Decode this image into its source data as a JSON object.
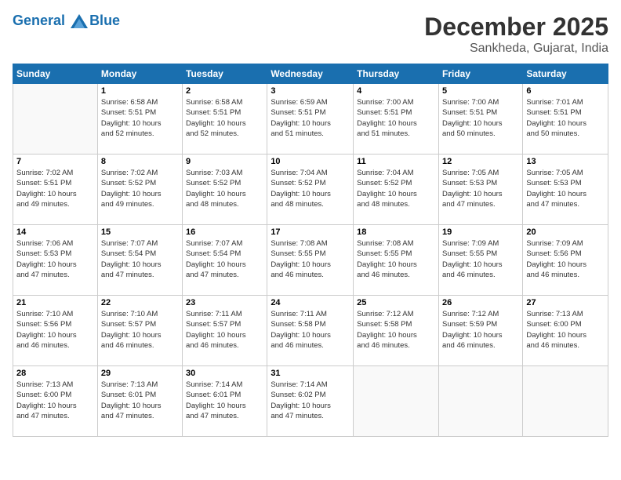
{
  "header": {
    "logo_line1": "General",
    "logo_line2": "Blue",
    "title": "December 2025",
    "subtitle": "Sankheda, Gujarat, India"
  },
  "weekdays": [
    "Sunday",
    "Monday",
    "Tuesday",
    "Wednesday",
    "Thursday",
    "Friday",
    "Saturday"
  ],
  "weeks": [
    [
      {
        "day": "",
        "info": ""
      },
      {
        "day": "1",
        "info": "Sunrise: 6:58 AM\nSunset: 5:51 PM\nDaylight: 10 hours\nand 52 minutes."
      },
      {
        "day": "2",
        "info": "Sunrise: 6:58 AM\nSunset: 5:51 PM\nDaylight: 10 hours\nand 52 minutes."
      },
      {
        "day": "3",
        "info": "Sunrise: 6:59 AM\nSunset: 5:51 PM\nDaylight: 10 hours\nand 51 minutes."
      },
      {
        "day": "4",
        "info": "Sunrise: 7:00 AM\nSunset: 5:51 PM\nDaylight: 10 hours\nand 51 minutes."
      },
      {
        "day": "5",
        "info": "Sunrise: 7:00 AM\nSunset: 5:51 PM\nDaylight: 10 hours\nand 50 minutes."
      },
      {
        "day": "6",
        "info": "Sunrise: 7:01 AM\nSunset: 5:51 PM\nDaylight: 10 hours\nand 50 minutes."
      }
    ],
    [
      {
        "day": "7",
        "info": "Sunrise: 7:02 AM\nSunset: 5:51 PM\nDaylight: 10 hours\nand 49 minutes."
      },
      {
        "day": "8",
        "info": "Sunrise: 7:02 AM\nSunset: 5:52 PM\nDaylight: 10 hours\nand 49 minutes."
      },
      {
        "day": "9",
        "info": "Sunrise: 7:03 AM\nSunset: 5:52 PM\nDaylight: 10 hours\nand 48 minutes."
      },
      {
        "day": "10",
        "info": "Sunrise: 7:04 AM\nSunset: 5:52 PM\nDaylight: 10 hours\nand 48 minutes."
      },
      {
        "day": "11",
        "info": "Sunrise: 7:04 AM\nSunset: 5:52 PM\nDaylight: 10 hours\nand 48 minutes."
      },
      {
        "day": "12",
        "info": "Sunrise: 7:05 AM\nSunset: 5:53 PM\nDaylight: 10 hours\nand 47 minutes."
      },
      {
        "day": "13",
        "info": "Sunrise: 7:05 AM\nSunset: 5:53 PM\nDaylight: 10 hours\nand 47 minutes."
      }
    ],
    [
      {
        "day": "14",
        "info": "Sunrise: 7:06 AM\nSunset: 5:53 PM\nDaylight: 10 hours\nand 47 minutes."
      },
      {
        "day": "15",
        "info": "Sunrise: 7:07 AM\nSunset: 5:54 PM\nDaylight: 10 hours\nand 47 minutes."
      },
      {
        "day": "16",
        "info": "Sunrise: 7:07 AM\nSunset: 5:54 PM\nDaylight: 10 hours\nand 47 minutes."
      },
      {
        "day": "17",
        "info": "Sunrise: 7:08 AM\nSunset: 5:55 PM\nDaylight: 10 hours\nand 46 minutes."
      },
      {
        "day": "18",
        "info": "Sunrise: 7:08 AM\nSunset: 5:55 PM\nDaylight: 10 hours\nand 46 minutes."
      },
      {
        "day": "19",
        "info": "Sunrise: 7:09 AM\nSunset: 5:55 PM\nDaylight: 10 hours\nand 46 minutes."
      },
      {
        "day": "20",
        "info": "Sunrise: 7:09 AM\nSunset: 5:56 PM\nDaylight: 10 hours\nand 46 minutes."
      }
    ],
    [
      {
        "day": "21",
        "info": "Sunrise: 7:10 AM\nSunset: 5:56 PM\nDaylight: 10 hours\nand 46 minutes."
      },
      {
        "day": "22",
        "info": "Sunrise: 7:10 AM\nSunset: 5:57 PM\nDaylight: 10 hours\nand 46 minutes."
      },
      {
        "day": "23",
        "info": "Sunrise: 7:11 AM\nSunset: 5:57 PM\nDaylight: 10 hours\nand 46 minutes."
      },
      {
        "day": "24",
        "info": "Sunrise: 7:11 AM\nSunset: 5:58 PM\nDaylight: 10 hours\nand 46 minutes."
      },
      {
        "day": "25",
        "info": "Sunrise: 7:12 AM\nSunset: 5:58 PM\nDaylight: 10 hours\nand 46 minutes."
      },
      {
        "day": "26",
        "info": "Sunrise: 7:12 AM\nSunset: 5:59 PM\nDaylight: 10 hours\nand 46 minutes."
      },
      {
        "day": "27",
        "info": "Sunrise: 7:13 AM\nSunset: 6:00 PM\nDaylight: 10 hours\nand 46 minutes."
      }
    ],
    [
      {
        "day": "28",
        "info": "Sunrise: 7:13 AM\nSunset: 6:00 PM\nDaylight: 10 hours\nand 47 minutes."
      },
      {
        "day": "29",
        "info": "Sunrise: 7:13 AM\nSunset: 6:01 PM\nDaylight: 10 hours\nand 47 minutes."
      },
      {
        "day": "30",
        "info": "Sunrise: 7:14 AM\nSunset: 6:01 PM\nDaylight: 10 hours\nand 47 minutes."
      },
      {
        "day": "31",
        "info": "Sunrise: 7:14 AM\nSunset: 6:02 PM\nDaylight: 10 hours\nand 47 minutes."
      },
      {
        "day": "",
        "info": ""
      },
      {
        "day": "",
        "info": ""
      },
      {
        "day": "",
        "info": ""
      }
    ]
  ]
}
